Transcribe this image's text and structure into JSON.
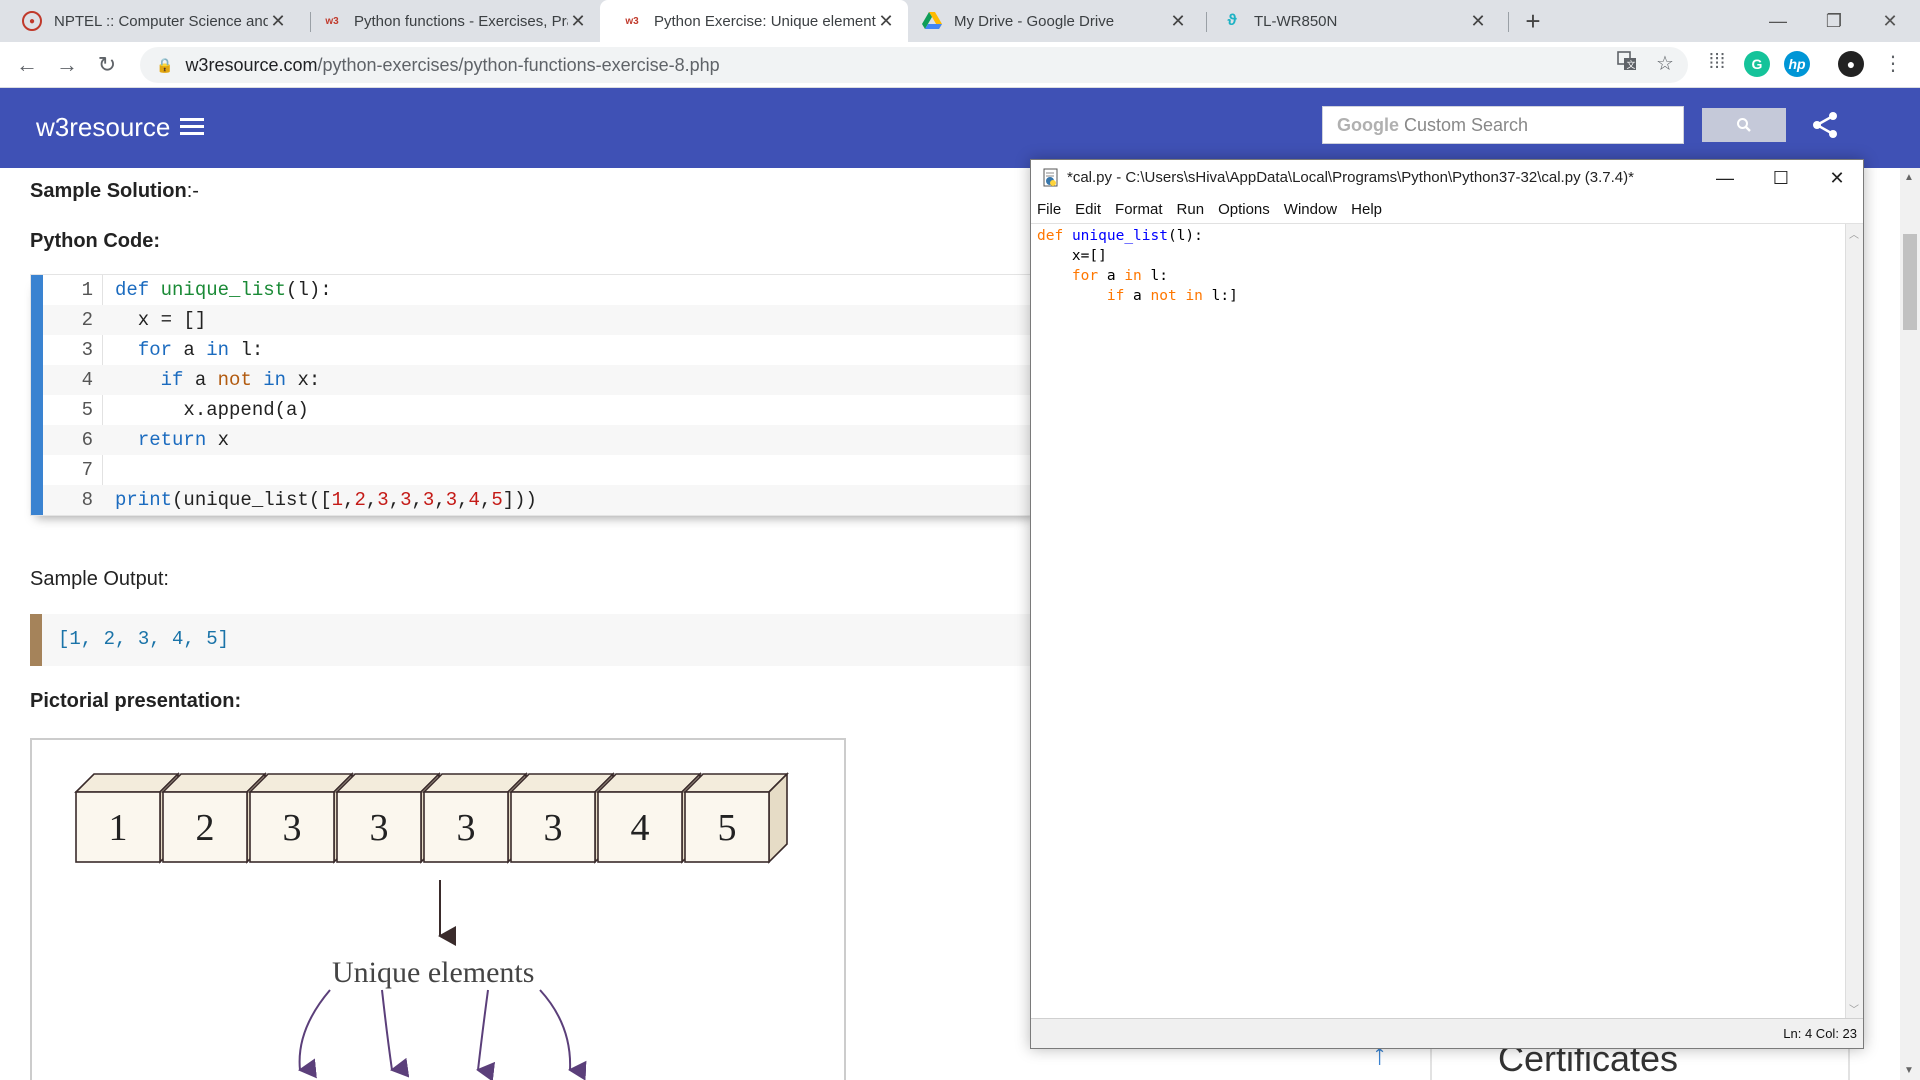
{
  "browser": {
    "tabs": [
      {
        "title": "NPTEL :: Computer Science and E",
        "active": false
      },
      {
        "title": "Python functions - Exercises, Prac",
        "active": false
      },
      {
        "title": "Python Exercise: Unique element",
        "active": true
      },
      {
        "title": "My Drive - Google Drive",
        "active": false
      },
      {
        "title": "TL-WR850N",
        "active": false
      }
    ],
    "url_host": "w3resource.com",
    "url_path": "/python-exercises/python-functions-exercise-8.php"
  },
  "site": {
    "logo": "w3resource",
    "search_brand": "Google",
    "search_placeholder": "Custom Search"
  },
  "page": {
    "sample_solution_bold": "Sample Solution",
    "sample_solution_rest": ":-",
    "python_code_heading": "Python Code:",
    "code_line_numbers": [
      "1",
      "2",
      "3",
      "4",
      "5",
      "6",
      "7",
      "8"
    ],
    "sample_output_heading": "Sample Output:",
    "sample_output": "[1, 2, 3, 4, 5]",
    "pictorial_heading": "Pictorial presentation:",
    "pictorial_boxes": [
      "1",
      "2",
      "3",
      "3",
      "3",
      "3",
      "4",
      "5"
    ],
    "pictorial_caption": "Unique elements",
    "side_card_title": "Certificates"
  },
  "idle": {
    "title": "*cal.py - C:\\Users\\sHiva\\AppData\\Local\\Programs\\Python\\Python37-32\\cal.py (3.7.4)*",
    "menu": [
      "File",
      "Edit",
      "Format",
      "Run",
      "Options",
      "Window",
      "Help"
    ],
    "status": "Ln: 4   Col: 23"
  }
}
